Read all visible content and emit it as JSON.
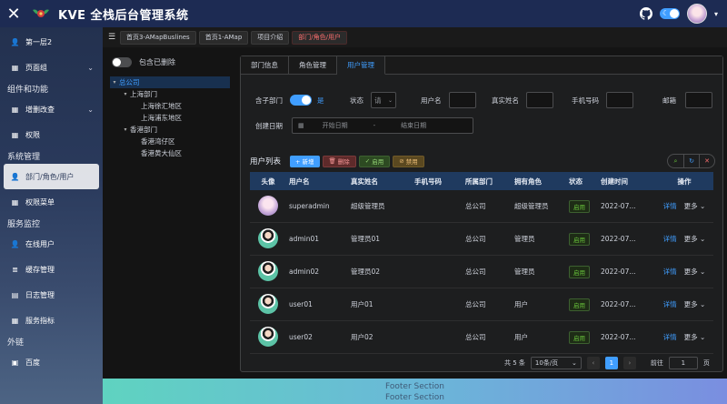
{
  "header": {
    "close_symbol": "✕",
    "title": "KVE 全栈后台管理系统",
    "icons": [
      "close-icon",
      "logo-icon",
      "github-icon",
      "theme-toggle",
      "avatar"
    ]
  },
  "sidebar": {
    "items": [
      {
        "type": "item",
        "label": "第一层2",
        "icon": "user-icon"
      },
      {
        "type": "item",
        "label": "页面组",
        "icon": "grid-icon",
        "arrow": "⌄"
      },
      {
        "type": "group",
        "label": "组件和功能"
      },
      {
        "type": "item",
        "label": "增删改查",
        "icon": "grid-icon",
        "arrow": "⌄"
      },
      {
        "type": "item",
        "label": "权限",
        "icon": "grid-icon"
      },
      {
        "type": "group",
        "label": "系统管理"
      },
      {
        "type": "item",
        "label": "部门/角色/用户",
        "icon": "user-icon",
        "active": true
      },
      {
        "type": "item",
        "label": "权限菜单",
        "icon": "grid-icon"
      },
      {
        "type": "group",
        "label": "服务监控"
      },
      {
        "type": "item",
        "label": "在线用户",
        "icon": "user-icon"
      },
      {
        "type": "item",
        "label": "缓存管理",
        "icon": "database-icon"
      },
      {
        "type": "item",
        "label": "日志管理",
        "icon": "calendar-icon"
      },
      {
        "type": "item",
        "label": "服务指标",
        "icon": "grid-icon"
      },
      {
        "type": "group",
        "label": "外链"
      },
      {
        "type": "item",
        "label": "百度",
        "icon": "link-icon"
      }
    ]
  },
  "tabs": [
    {
      "label": "首页3-AMapBuslines",
      "active": false
    },
    {
      "label": "首页1-AMap",
      "active": false
    },
    {
      "label": "项目介绍",
      "active": false
    },
    {
      "label": "部门/角色/用户",
      "active": true
    }
  ],
  "tree": {
    "include_deleted_label": "包含已删除",
    "nodes": [
      {
        "label": "总公司",
        "level": 0,
        "twisty": "▾"
      },
      {
        "label": "上海部门",
        "level": 1,
        "twisty": "▾"
      },
      {
        "label": "上海徐汇地区",
        "level": 2,
        "twisty": ""
      },
      {
        "label": "上海浦东地区",
        "level": 2,
        "twisty": ""
      },
      {
        "label": "香港部门",
        "level": 1,
        "twisty": "▾"
      },
      {
        "label": "香港湾仔区",
        "level": 2,
        "twisty": ""
      },
      {
        "label": "香港黄大仙区",
        "level": 2,
        "twisty": ""
      }
    ]
  },
  "card": {
    "tabs": [
      {
        "label": "部门信息",
        "active": false
      },
      {
        "label": "角色管理",
        "active": false
      },
      {
        "label": "用户管理",
        "active": true
      }
    ]
  },
  "filters": {
    "include_sub_label": "含子部门",
    "include_sub_value": "是",
    "status_label": "状态",
    "status_value": "请",
    "username_label": "用户名",
    "realname_label": "真实姓名",
    "phone_label": "手机号码",
    "email_label": "邮箱",
    "created_label": "创建日期",
    "start_placeholder": "开始日期",
    "range_sep": "-",
    "end_placeholder": "结束日期"
  },
  "toolbar": {
    "title": "用户列表",
    "add": "+ 新增",
    "delete": "删除",
    "enable": "启用",
    "disable": "禁用"
  },
  "table": {
    "columns": [
      "头像",
      "用户名",
      "真实姓名",
      "手机号码",
      "所属部门",
      "拥有角色",
      "状态",
      "创建时间",
      "操作"
    ],
    "rows": [
      {
        "avatar": "super",
        "username": "superadmin",
        "realname": "超级管理员",
        "phone": "",
        "dept": "总公司",
        "role": "超级管理员",
        "status": "启用",
        "created": "2022-07...",
        "detail": "详情",
        "more": "更多"
      },
      {
        "avatar": "user",
        "username": "admin01",
        "realname": "管理员01",
        "phone": "",
        "dept": "总公司",
        "role": "管理员",
        "status": "启用",
        "created": "2022-07...",
        "detail": "详情",
        "more": "更多"
      },
      {
        "avatar": "user",
        "username": "admin02",
        "realname": "管理员02",
        "phone": "",
        "dept": "总公司",
        "role": "管理员",
        "status": "启用",
        "created": "2022-07...",
        "detail": "详情",
        "more": "更多"
      },
      {
        "avatar": "user",
        "username": "user01",
        "realname": "用户01",
        "phone": "",
        "dept": "总公司",
        "role": "用户",
        "status": "启用",
        "created": "2022-07...",
        "detail": "详情",
        "more": "更多"
      },
      {
        "avatar": "user",
        "username": "user02",
        "realname": "用户02",
        "phone": "",
        "dept": "总公司",
        "role": "用户",
        "status": "启用",
        "created": "2022-07...",
        "detail": "详情",
        "more": "更多"
      }
    ]
  },
  "pagination": {
    "total": "共 5 条",
    "page_size": "10条/页",
    "current_page": "1",
    "goto_label": "前往",
    "goto_value": "1",
    "page_unit": "页"
  },
  "footer": {
    "line1": "Footer Section",
    "line2": "Footer Section"
  },
  "colors": {
    "accent": "#409eff",
    "header_bg": "#1d2b53",
    "active_tab": "#f56c6c",
    "success": "#67c23a"
  }
}
